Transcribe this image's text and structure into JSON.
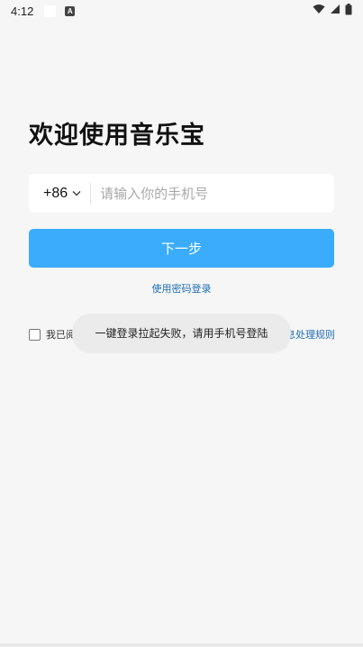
{
  "status_bar": {
    "time": "4:12",
    "icons": [
      "notification-square-icon",
      "a-badge-icon",
      "wifi-icon",
      "signal-icon",
      "battery-icon"
    ]
  },
  "login": {
    "title": "欢迎使用音乐宝",
    "country_code": "+86",
    "phone_placeholder": "请输入你的手机号",
    "phone_value": "",
    "next_button": "下一步",
    "password_login": "使用密码登录"
  },
  "agreement": {
    "prefix": "我已阅读并",
    "suffix_link": "息处理规则",
    "checked": false
  },
  "toast": {
    "message": "一键登录拉起失败，请用手机号登陆"
  },
  "colors": {
    "accent": "#3aacfb",
    "link": "#1f6fb4",
    "background": "#f6f6f6"
  }
}
